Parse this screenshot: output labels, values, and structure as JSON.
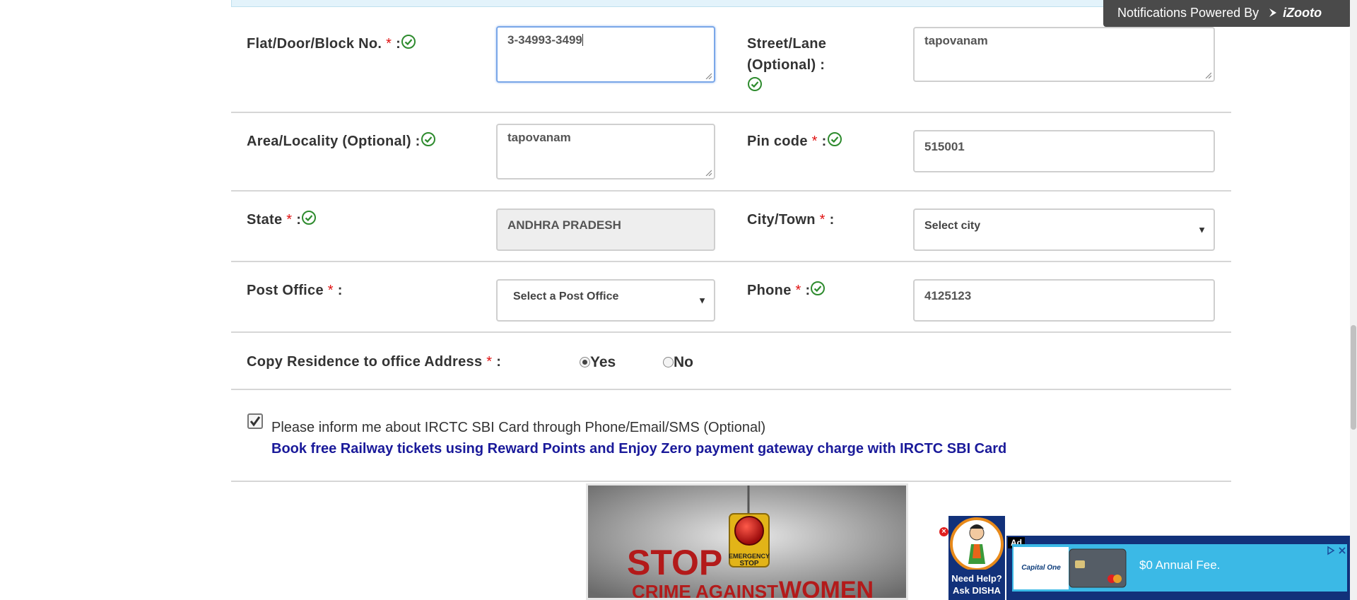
{
  "notification": {
    "text": "Notifications Powered By",
    "brand": "iZooto"
  },
  "form": {
    "flat": {
      "label": "Flat/Door/Block No.",
      "value": "3-34993-3499"
    },
    "street": {
      "label1": "Street/Lane",
      "label2": "(Optional) :",
      "value": "tapovanam"
    },
    "area": {
      "label": "Area/Locality (Optional) :",
      "value": "tapovanam"
    },
    "pin": {
      "label": "Pin code",
      "value": "515001"
    },
    "state": {
      "label": "State",
      "value": "ANDHRA PRADESH"
    },
    "city": {
      "label": "City/Town",
      "value": "Select city"
    },
    "post_office": {
      "label": "Post Office",
      "value": "Select a Post Office"
    },
    "phone": {
      "label": "Phone",
      "value": "4125123"
    },
    "copy": {
      "label": "Copy Residence to office Address",
      "yes": "Yes",
      "no": "No",
      "selected": "Yes"
    },
    "required_mark": "*",
    "colon": ":",
    "inform_text": "Please inform me about IRCTC SBI Card through Phone/Email/SMS (Optional)",
    "promo_text": "Book free Railway tickets using Reward Points and Enjoy Zero payment gateway charge with IRCTC SBI Card",
    "inform_checked": true
  },
  "poster": {
    "stop": "STOP",
    "button_text1": "EMERGENCY",
    "button_text2": "STOP",
    "line": "CRIME AGAINST",
    "women": "WOMEN"
  },
  "help": {
    "line1": "Need Help?",
    "line2": "Ask DISHA"
  },
  "ad": {
    "badge": "Ad",
    "brand": "Capital One",
    "headline": "$0 Annual Fee."
  },
  "colors": {
    "accent_check": "#2e8b2e",
    "required": "#e01010",
    "promo": "#1a1a9a",
    "ad_bg": "#3bb9e6",
    "notif_bg": "#4a4a4a"
  }
}
